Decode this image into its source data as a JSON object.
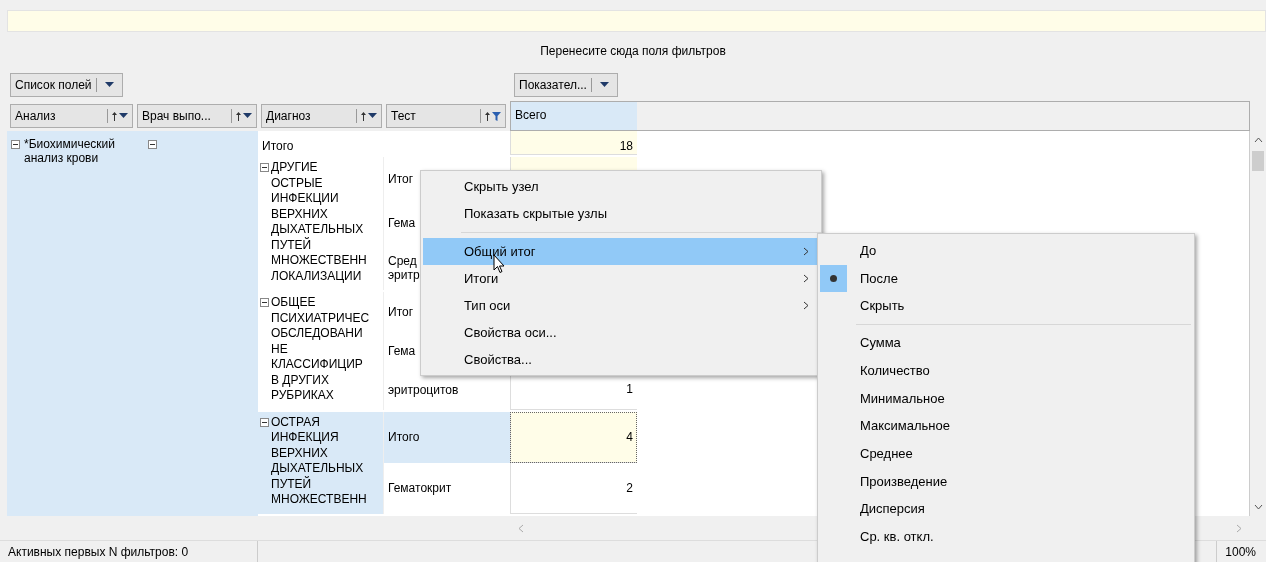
{
  "filter_area": {
    "label": "Перенесите сюда поля фильтров"
  },
  "column_buttons": [
    {
      "label": "Список полей"
    }
  ],
  "data_buttons": [
    {
      "label": "Показател..."
    }
  ],
  "row_fields": [
    {
      "label": "Анализ",
      "filtered": false
    },
    {
      "label": "Врач выпо...",
      "filtered": false
    },
    {
      "label": "Диагноз",
      "filtered": false
    },
    {
      "label": "Тест",
      "filtered": true
    }
  ],
  "data_header": "Всего",
  "analysis": {
    "label": "*Биохимический\nанализ крови",
    "expanded": true
  },
  "doctor": {
    "expanded": true
  },
  "grand_total": {
    "label": "Итого",
    "value": "18"
  },
  "groups": [
    {
      "diagnosis": "ДРУГИЕ\nОСТРЫЕ\nИНФЕКЦИИ\nВЕРХНИХ\nДЫХАТЕЛЬНЫХ\nПУТЕЙ\nМНОЖЕСТВЕНН\nЛОКАЛИЗАЦИИ",
      "expanded": true,
      "selected": false,
      "rows": [
        {
          "kind": "total",
          "test": "Итог"
        },
        {
          "kind": "item",
          "test": "Гема"
        },
        {
          "kind": "item",
          "test": "Сред\nэритр"
        }
      ]
    },
    {
      "diagnosis": "ОБЩЕЕ\nПСИХИАТРИЧЕС\nОБСЛЕДОВАНИ\nНЕ\nКЛАССИФИЦИР\nВ ДРУГИХ\nРУБРИКАХ",
      "expanded": true,
      "selected": false,
      "rows": [
        {
          "kind": "total",
          "test": "Итог"
        },
        {
          "kind": "item",
          "test": "Гема"
        },
        {
          "kind": "item",
          "test": "эритроцитов",
          "value": "1"
        }
      ]
    },
    {
      "diagnosis": "ОСТРАЯ\nИНФЕКЦИЯ\nВЕРХНИХ\nДЫХАТЕЛЬНЫХ\nПУТЕЙ\nМНОЖЕСТВЕНН",
      "expanded": true,
      "selected": true,
      "rows": [
        {
          "kind": "total",
          "test": "Итого",
          "value": "4"
        },
        {
          "kind": "item",
          "test": "Гематокрит",
          "value": "2"
        }
      ]
    }
  ],
  "context_menu": [
    {
      "kind": "item",
      "label": "Скрыть узел",
      "submenu": false,
      "selected": false
    },
    {
      "kind": "item",
      "label": "Показать скрытые узлы",
      "submenu": false,
      "selected": false
    },
    {
      "kind": "separator"
    },
    {
      "kind": "item",
      "label": "Общий итог",
      "submenu": true,
      "selected": true
    },
    {
      "kind": "item",
      "label": "Итоги",
      "submenu": true,
      "selected": false
    },
    {
      "kind": "item",
      "label": "Тип оси",
      "submenu": true,
      "selected": false
    },
    {
      "kind": "item",
      "label": "Свойства оси...",
      "submenu": false,
      "selected": false
    },
    {
      "kind": "item",
      "label": "Свойства...",
      "submenu": false,
      "selected": false
    }
  ],
  "submenu": [
    {
      "kind": "radio",
      "label": "До",
      "checked": false
    },
    {
      "kind": "radio",
      "label": "После",
      "checked": true
    },
    {
      "kind": "radio",
      "label": "Скрыть",
      "checked": false
    },
    {
      "kind": "separator"
    },
    {
      "kind": "item",
      "label": "Сумма"
    },
    {
      "kind": "item",
      "label": "Количество"
    },
    {
      "kind": "item",
      "label": "Минимальное"
    },
    {
      "kind": "item",
      "label": "Максимальное"
    },
    {
      "kind": "item",
      "label": "Среднее"
    },
    {
      "kind": "item",
      "label": "Произведение"
    },
    {
      "kind": "item",
      "label": "Дисперсия"
    },
    {
      "kind": "item",
      "label": "Ср. кв. откл."
    }
  ],
  "status_bar": {
    "text": "Активных первых N фильтров: 0",
    "zoom": "100%"
  }
}
